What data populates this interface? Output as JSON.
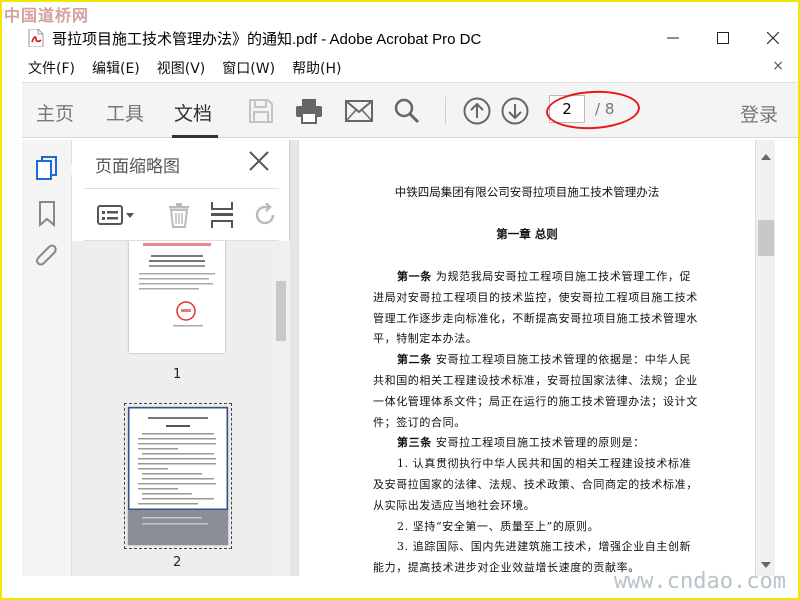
{
  "watermark": {
    "top": "中国道桥网",
    "bottom": "www.cndao.com"
  },
  "window": {
    "title": "哥拉项目施工技术管理办法》的通知.pdf - Adobe Acrobat Pro DC",
    "icon": "pdf-file-icon"
  },
  "menu": {
    "items": [
      "文件(F)",
      "编辑(E)",
      "视图(V)",
      "窗口(W)",
      "帮助(H)"
    ],
    "close": "×"
  },
  "toolbar": {
    "tabs": [
      "主页",
      "工具",
      "文档"
    ],
    "active_tab": "文档",
    "icons": [
      "save-icon",
      "print-icon",
      "email-icon",
      "search-icon",
      "page-up-icon",
      "page-down-icon"
    ],
    "page_current": "2",
    "page_total": "/ 8",
    "login": "登录",
    "highlight_color": "#e8181a"
  },
  "rail": {
    "icons": [
      "page-thumbnails-icon",
      "bookmark-icon",
      "attachment-icon"
    ]
  },
  "panel": {
    "title": "页面缩略图",
    "tools": [
      "options-menu-icon",
      "delete-icon",
      "insert-pages-icon",
      "rotate-icon"
    ],
    "thumbnails": [
      {
        "label": "1"
      },
      {
        "label": "2",
        "selected": true
      }
    ]
  },
  "document": {
    "title": "中铁四局集团有限公司安哥拉项目施工技术管理办法",
    "chapter": "第一章   总则",
    "lines": [
      {
        "text": "为规范我局安哥拉工程项目施工技术管理工作，促",
        "lead": "第一条",
        "indent": true
      },
      {
        "text": "进局对安哥拉工程项目的技术监控，使安哥拉工程项目施工技术"
      },
      {
        "text": "管理工作逐步走向标准化，不断提高安哥拉项目施工技术管理水"
      },
      {
        "text": "平，特制定本办法。"
      },
      {
        "text": "安哥拉工程项目施工技术管理的依据是：中华人民",
        "lead": "第二条",
        "indent": true
      },
      {
        "text": "共和国的相关工程建设技术标准，安哥拉国家法律、法规；企业"
      },
      {
        "text": "一体化管理体系文件；局正在运行的施工技术管理办法；设计文"
      },
      {
        "text": "件；签订的合同。"
      },
      {
        "text": "安哥拉工程项目施工技术管理的原则是：",
        "lead": "第三条",
        "indent": true
      },
      {
        "text": "1. 认真贯彻执行中华人民共和国的相关工程建设技术标准",
        "indent": true
      },
      {
        "text": "及安哥拉国家的法律、法规、技术政策、合同商定的技术标准，"
      },
      {
        "text": "从实际出发适应当地社会环境。"
      },
      {
        "text": "2. 坚持“安全第一、质量至上”的原则。",
        "indent": true
      },
      {
        "text": "3. 追踪国际、国内先进建筑施工技术，增强企业自主创新",
        "indent": true
      },
      {
        "text": "能力，提高技术进步对企业效益增长速度的贡献率。"
      }
    ]
  }
}
